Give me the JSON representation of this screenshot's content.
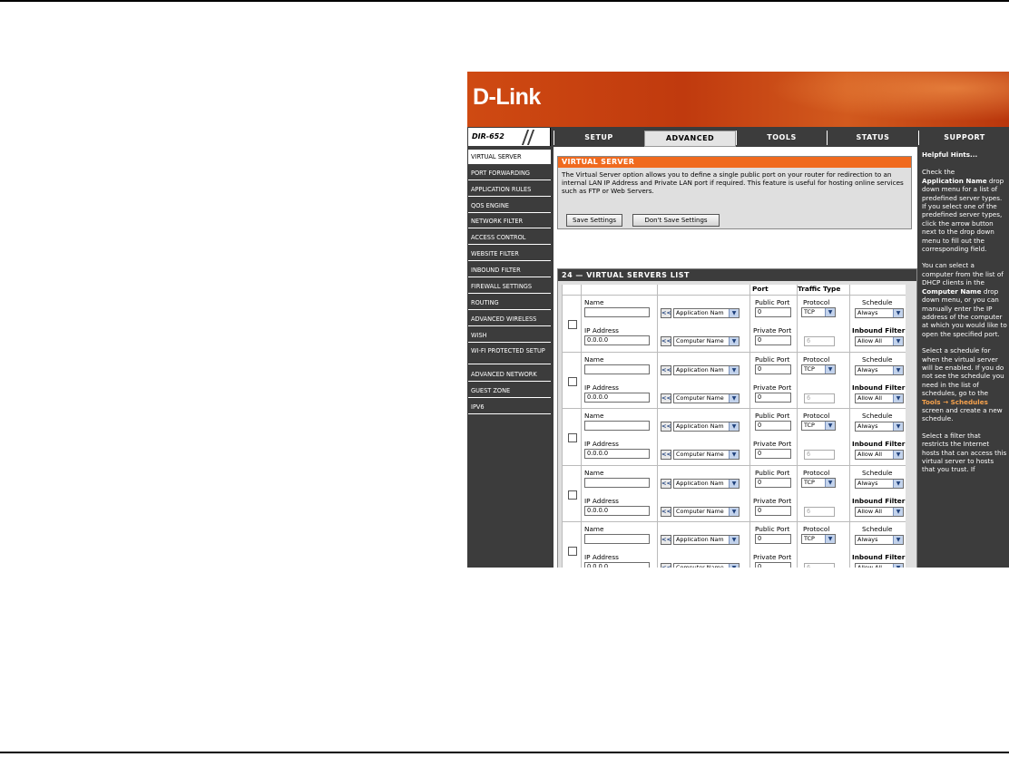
{
  "router": {
    "brand": "D-Link",
    "model": "DIR-652"
  },
  "tabs": [
    {
      "label": "SETUP"
    },
    {
      "label": "ADVANCED"
    },
    {
      "label": "TOOLS"
    },
    {
      "label": "STATUS"
    },
    {
      "label": "SUPPORT"
    }
  ],
  "sidebar": {
    "items": [
      {
        "label": "VIRTUAL SERVER"
      },
      {
        "label": "PORT FORWARDING"
      },
      {
        "label": "APPLICATION RULES"
      },
      {
        "label": "QOS ENGINE"
      },
      {
        "label": "NETWORK FILTER"
      },
      {
        "label": "ACCESS CONTROL"
      },
      {
        "label": "WEBSITE FILTER"
      },
      {
        "label": "INBOUND FILTER"
      },
      {
        "label": "FIREWALL SETTINGS"
      },
      {
        "label": "ROUTING"
      },
      {
        "label": "ADVANCED WIRELESS"
      },
      {
        "label": "WISH"
      },
      {
        "label": "WI-FI PROTECTED SETUP"
      },
      {
        "label": "ADVANCED NETWORK"
      },
      {
        "label": "GUEST ZONE"
      },
      {
        "label": "IPV6"
      }
    ]
  },
  "virtual_server": {
    "title": "VIRTUAL SERVER",
    "description": "The Virtual Server option allows you to define a single public port on your router for redirection to an internal LAN IP Address and Private LAN port if required. This feature is useful for hosting online services such as FTP or Web Servers.",
    "save_label": "Save Settings",
    "dont_save_label": "Don't Save Settings"
  },
  "list": {
    "title": "24 — VIRTUAL SERVERS LIST",
    "header_port": "Port",
    "header_traffic": "Traffic Type",
    "label_name": "Name",
    "label_ip": "IP Address",
    "label_public_port": "Public Port",
    "label_private_port": "Private Port",
    "label_protocol": "Protocol",
    "label_schedule": "Schedule",
    "label_inbound": "Inbound Filter",
    "arrow_button": "<<",
    "rows": [
      {
        "name": "",
        "ip": "0.0.0.0",
        "app": "Application Nam",
        "computer": "Computer Name",
        "public_port": "0",
        "private_port": "0",
        "protocol": "TCP",
        "protocol_num": "6",
        "schedule": "Always",
        "inbound": "Allow All"
      },
      {
        "name": "",
        "ip": "0.0.0.0",
        "app": "Application Nam",
        "computer": "Computer Name",
        "public_port": "0",
        "private_port": "0",
        "protocol": "TCP",
        "protocol_num": "6",
        "schedule": "Always",
        "inbound": "Allow All"
      },
      {
        "name": "",
        "ip": "0.0.0.0",
        "app": "Application Nam",
        "computer": "Computer Name",
        "public_port": "0",
        "private_port": "0",
        "protocol": "TCP",
        "protocol_num": "6",
        "schedule": "Always",
        "inbound": "Allow All"
      },
      {
        "name": "",
        "ip": "0.0.0.0",
        "app": "Application Nam",
        "computer": "Computer Name",
        "public_port": "0",
        "private_port": "0",
        "protocol": "TCP",
        "protocol_num": "6",
        "schedule": "Always",
        "inbound": "Allow All"
      },
      {
        "name": "",
        "ip": "0.0.0.0",
        "app": "Application Nam",
        "computer": "Computer Name",
        "public_port": "0",
        "private_port": "0",
        "protocol": "TCP",
        "protocol_num": "6",
        "schedule": "Always",
        "inbound": "Allow All"
      }
    ]
  },
  "hints": {
    "title": "Helpful Hints...",
    "p1_pre": "Check the",
    "p1_bold": "Application Name",
    "p1_post": "drop down menu for a list of predefined server types. If you select one of the predefined server types, click the arrow button next to the drop down menu to fill out the corresponding field.",
    "p2_pre": "You can select a computer from the list of DHCP clients in the",
    "p2_bold": "Computer Name",
    "p2_post": "drop down menu, or you can manually enter the IP address of the computer at which you would like to open the specified port.",
    "p3_pre": "Select a schedule for when the virtual server will be enabled. If you do not see the schedule you need in the list of schedules, go to the",
    "p3_link": "Tools → Schedules",
    "p3_post": "screen and create a new schedule.",
    "p4": "Select a filter that restricts the Internet hosts that can access this virtual server to hosts that you trust. If"
  },
  "colors": {
    "accent": "#f06a1e",
    "dark": "#3c3c3c",
    "link": "#f7a24c"
  }
}
